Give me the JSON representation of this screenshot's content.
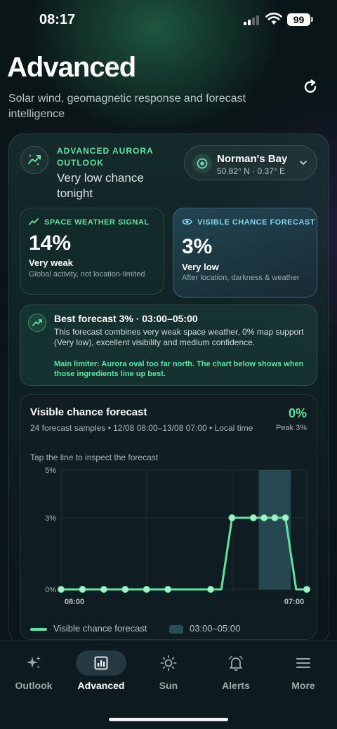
{
  "status_bar": {
    "time": "08:17",
    "battery": "99"
  },
  "header": {
    "title": "Advanced",
    "subtitle": "Solar wind, geomagnetic response and forecast intelligence",
    "refresh_icon": "refresh-icon"
  },
  "outlook": {
    "kicker": "ADVANCED AURORA OUTLOOK",
    "chance_text": "Very low chance tonight",
    "icon": "aurora-trend-icon"
  },
  "location": {
    "name": "Norman's Bay",
    "coords": "50.82° N · 0.37° E",
    "icon": "location-target-icon"
  },
  "space_weather": {
    "heading": "SPACE WEATHER SIGNAL",
    "value": "14%",
    "level": "Very weak",
    "note": "Global activity, not location-limited"
  },
  "visible_chance": {
    "heading": "VISIBLE CHANCE FORECAST",
    "value": "3%",
    "level": "Very low",
    "note": "After location, darkness & weather"
  },
  "best_forecast": {
    "title": "Best forecast 3% · 03:00–05:00",
    "body": "This forecast combines very weak space weather, 0% map support (Very low), excellent visibility and medium confidence.",
    "limiter": "Main limiter: Aurora oval too far north. The chart below shows when those ingredients line up best."
  },
  "chart": {
    "title": "Visible chance forecast",
    "meta": "24 forecast samples • 12/08 08:00–13/08 07:00 • Local time",
    "current": "0%",
    "peak": "Peak 3%",
    "hint": "Tap the line to inspect the forecast",
    "legend_series": "Visible chance forecast",
    "legend_window": "03:00–05:00"
  },
  "chart_data": {
    "type": "line",
    "title": "Visible chance forecast",
    "x": [
      "08:00",
      "09:00",
      "10:00",
      "11:00",
      "12:00",
      "13:00",
      "14:00",
      "15:00",
      "16:00",
      "17:00",
      "18:00",
      "19:00",
      "20:00",
      "21:00",
      "22:00",
      "23:00",
      "00:00",
      "01:00",
      "02:00",
      "03:00",
      "04:00",
      "05:00",
      "06:00",
      "07:00"
    ],
    "x_tick_labels": [
      "08:00",
      "07:00"
    ],
    "series": [
      {
        "name": "Visible chance forecast",
        "values": [
          0,
          0,
          0,
          0,
          0,
          0,
          0,
          0,
          0,
          0,
          0,
          0,
          0,
          0,
          0,
          0,
          3,
          3,
          3,
          3,
          3,
          3,
          0,
          0
        ]
      }
    ],
    "markers_at": [
      "08:00",
      "10:00",
      "12:00",
      "14:00",
      "16:00",
      "18:00",
      "22:00",
      "00:00",
      "02:00",
      "03:00",
      "04:00",
      "05:00",
      "07:00"
    ],
    "highlight_window": [
      "03:00",
      "05:00"
    ],
    "y_ticks": [
      "0%",
      "3%",
      "5%"
    ],
    "ylim": [
      0,
      5
    ],
    "grid": true,
    "color": "#5fe3a1"
  },
  "tabs": [
    {
      "label": "Outlook",
      "icon": "sparkles-icon",
      "active": false
    },
    {
      "label": "Advanced",
      "icon": "bar-chart-icon",
      "active": true
    },
    {
      "label": "Sun",
      "icon": "sun-icon",
      "active": false
    },
    {
      "label": "Alerts",
      "icon": "bell-icon",
      "active": false
    },
    {
      "label": "More",
      "icon": "menu-icon",
      "active": false
    }
  ]
}
